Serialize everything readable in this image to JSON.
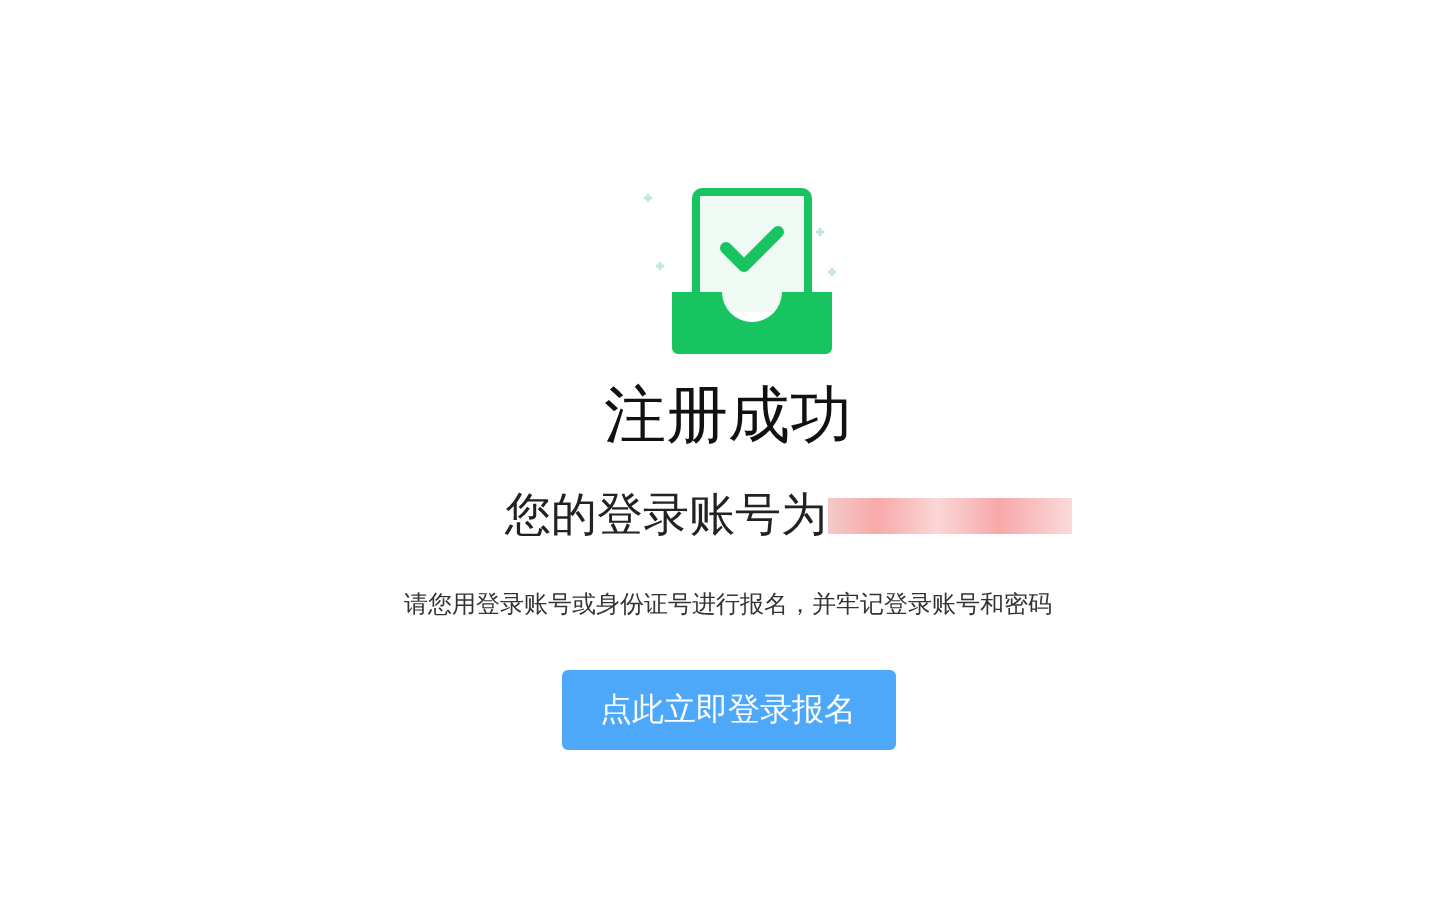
{
  "title": "注册成功",
  "account_label": "您的登录账号为",
  "note": "请您用登录账号或身份证号进行报名，并牢记登录账号和密码",
  "button": {
    "label": "点此立即登录报名"
  }
}
